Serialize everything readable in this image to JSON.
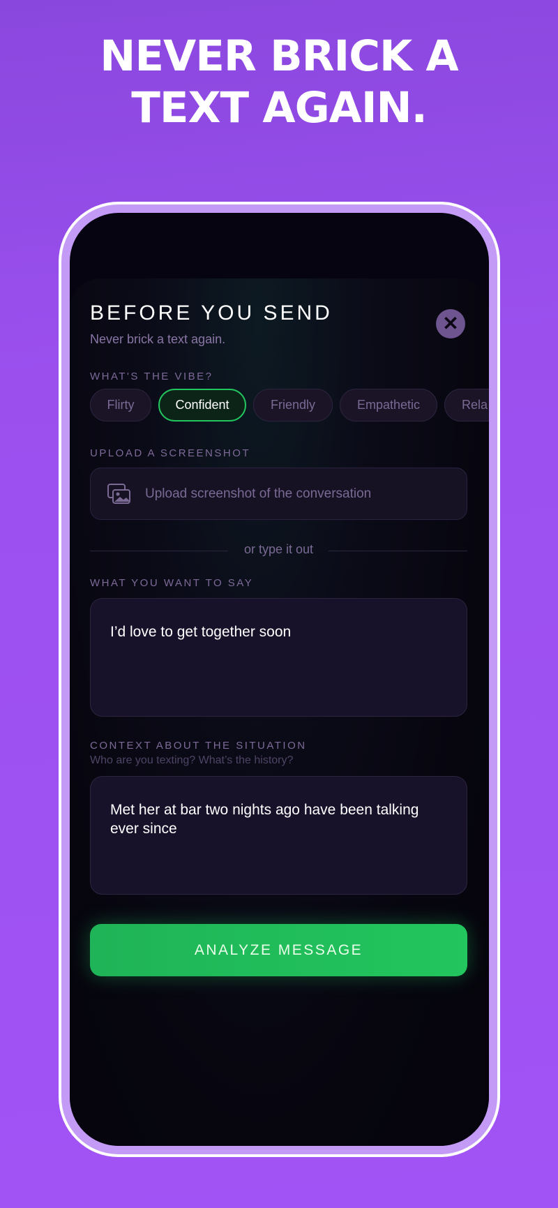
{
  "headline": {
    "line1": "NEVER BRICK A",
    "line2": "TEXT AGAIN."
  },
  "sheet": {
    "title": "BEFORE YOU SEND",
    "subtitle": "Never brick a text again.",
    "close_icon": "close-icon"
  },
  "vibe": {
    "label": "WHAT'S THE VIBE?",
    "options": [
      "Flirty",
      "Confident",
      "Friendly",
      "Empathetic",
      "Rela"
    ],
    "selected": "Confident"
  },
  "upload": {
    "label": "UPLOAD A SCREENSHOT",
    "placeholder": "Upload screenshot of the conversation",
    "icon": "image-gallery-icon"
  },
  "divider_text": "or type it out",
  "message": {
    "label": "WHAT YOU WANT TO SAY",
    "value": "I’d love to get together soon"
  },
  "context": {
    "label": "CONTEXT ABOUT THE SITUATION",
    "hint": "Who are you texting? What’s the history?",
    "value": "Met her at bar two nights ago have been talking ever since"
  },
  "analyze_button": "ANALYZE MESSAGE",
  "colors": {
    "background": "#a253f5",
    "accent_green": "#22c55e",
    "sheet_bg": "#07060f",
    "muted_text": "#7a6a94"
  }
}
